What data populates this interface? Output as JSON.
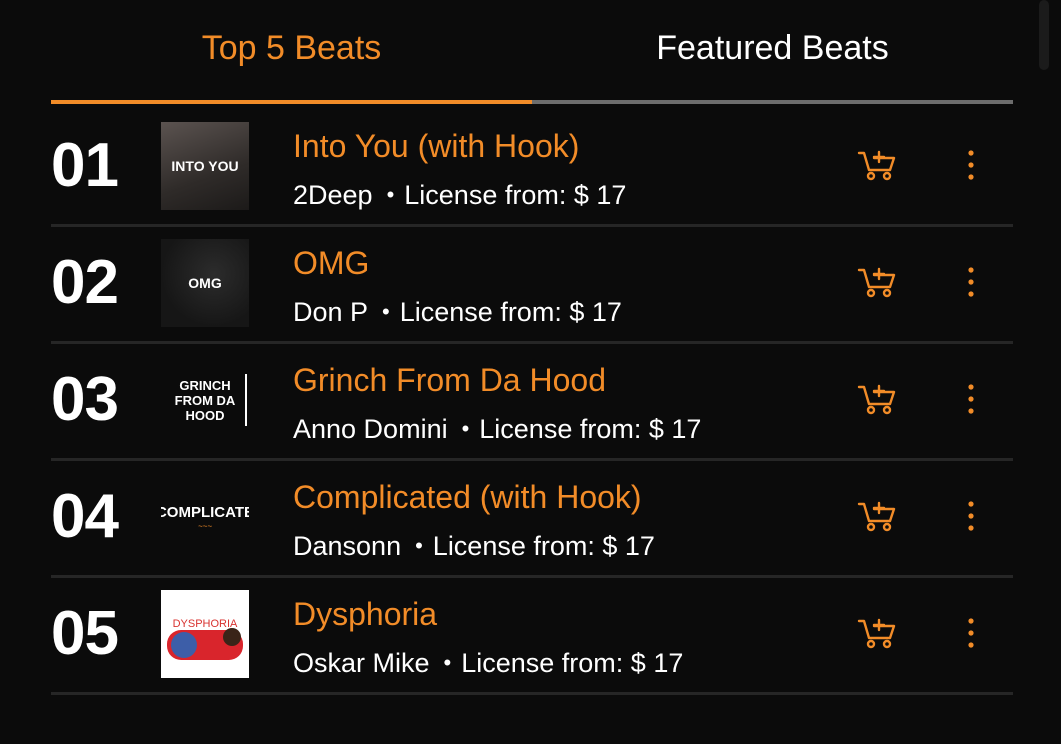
{
  "tabs": {
    "top5": "Top 5 Beats",
    "featured": "Featured Beats"
  },
  "colors": {
    "accent": "#f28c28",
    "background": "#0b0b0b",
    "text": "#ffffff",
    "inactive_tab_line": "#6d6d6d"
  },
  "beats": [
    {
      "rank": "01",
      "title": "Into You (with Hook)",
      "artist": "2Deep",
      "license": "License from: $ 17",
      "cover_text": "INTO YOU"
    },
    {
      "rank": "02",
      "title": "OMG",
      "artist": "Don P",
      "license": "License from: $ 17",
      "cover_text": "OMG"
    },
    {
      "rank": "03",
      "title": "Grinch From Da Hood",
      "artist": "Anno Domini",
      "license": "License from: $ 17",
      "cover_text": "GRINCH FROM DA HOOD"
    },
    {
      "rank": "04",
      "title": "Complicated (with Hook)",
      "artist": "Dansonn",
      "license": "License from: $ 17",
      "cover_text": "COMPLICATE"
    },
    {
      "rank": "05",
      "title": "Dysphoria",
      "artist": "Oskar Mike",
      "license": "License from: $ 17",
      "cover_text": "DYSPHORIA"
    }
  ],
  "separator": "•",
  "icons": {
    "cart": "cart-add-icon",
    "more": "more-vertical-icon"
  }
}
